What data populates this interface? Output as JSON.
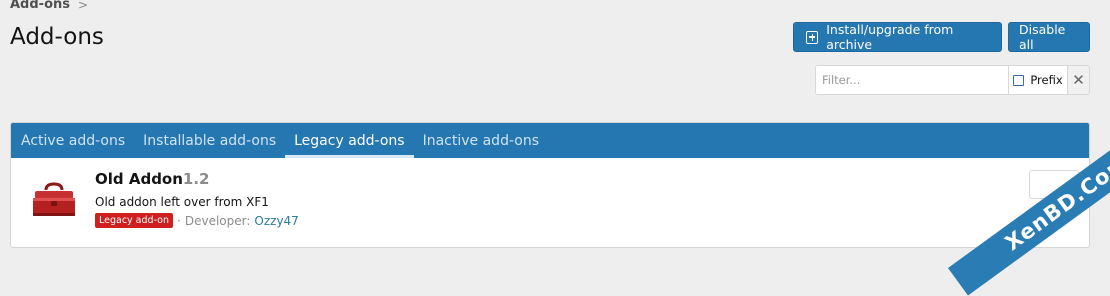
{
  "breadcrumb": {
    "items": [
      "Add-ons"
    ],
    "separator": ">"
  },
  "page": {
    "title": "Add-ons"
  },
  "actions": {
    "install_label": "Install/upgrade from archive",
    "disable_label": "Disable all"
  },
  "filter": {
    "placeholder": "Filter...",
    "value": "",
    "prefix_label": "Prefix",
    "prefix_checked": false,
    "clear_label": "✕"
  },
  "tabs": [
    {
      "label": "Active add-ons",
      "active": false
    },
    {
      "label": "Installable add-ons",
      "active": false
    },
    {
      "label": "Legacy add-ons",
      "active": true
    },
    {
      "label": "Inactive add-ons",
      "active": false
    }
  ],
  "addon": {
    "title": "Old Addon",
    "version": "1.2",
    "description": "Old addon left over from XF1",
    "badge": "Legacy add-on",
    "meta_separator": "·",
    "developer_label": "Developer:",
    "developer": "Ozzy47",
    "icon": "toolbox-icon"
  },
  "watermark": {
    "text": "XenBD.Com"
  },
  "colors": {
    "accent": "#2577b1",
    "badge": "#d01f1f",
    "link": "#2a7ca0",
    "background": "#eeeeee"
  }
}
